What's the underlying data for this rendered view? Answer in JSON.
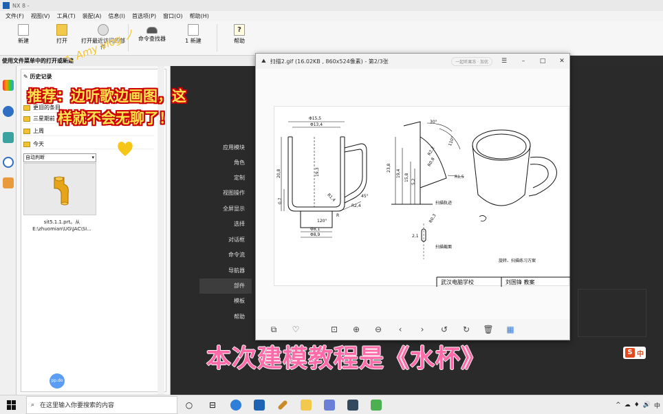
{
  "nx_window": {
    "title": "NX 8 -",
    "menu": [
      "文件(F)",
      "视图(V)",
      "工具(T)",
      "装配(A)",
      "信息(I)",
      "首选项(P)",
      "窗口(O)",
      "帮助(H)"
    ],
    "toolbar": {
      "new": "新建",
      "open": "打开",
      "recent": "打开最近访问的部件",
      "command_finder": "命令查找器",
      "new2": "1 新建",
      "help": "帮助"
    },
    "hint": "使用文件菜单中的打开或新建"
  },
  "history": {
    "title": "历史记录",
    "groups": [
      "更旧的条目",
      "三星期前",
      "上周",
      "今天"
    ],
    "filter": "自动判断",
    "file_line1": "sit5.1.1.prt。从",
    "file_line2": "E:\\zhuomian\\UG\\JAC\\SI..."
  },
  "right_menu": [
    "应用模块",
    "角色",
    "定制",
    "视图操作",
    "全屏显示",
    "选择",
    "对话框",
    "命令流",
    "导航器",
    "部件",
    "模板",
    "帮助"
  ],
  "viewer": {
    "title": "扫描2.gif (16.02KB , 860x524像素) - 第2/3张",
    "pill": "一起听果冻 · 加优",
    "window_buttons": [
      "☰",
      "–",
      "□",
      "✕"
    ],
    "bottom_icons": [
      "crop-icon",
      "heart-icon",
      "fit-icon",
      "zoom-in-icon",
      "zoom-out-icon",
      "prev-icon",
      "next-icon",
      "rotate-left-icon",
      "rotate-right-icon",
      "delete-icon",
      "grid-icon"
    ]
  },
  "drawing": {
    "dims": [
      "Φ15,5",
      "Φ13,4",
      "20,8",
      "19,3",
      "0,7",
      "R1,4",
      "R2,4",
      "Φ8,1",
      "Φ8,9",
      "120°",
      "R",
      "45°",
      "23,8",
      "19,4",
      "15,8",
      "5,2",
      "R2,2",
      "R0,8",
      "R1,5",
      "30°",
      "110°",
      "R0,3",
      "2,1"
    ],
    "labels": [
      "扫描轨迹",
      "扫描截面",
      "旋转、扫描练习方案"
    ],
    "table": [
      "武汉电脑学校",
      "刘国锋 教案"
    ]
  },
  "overlay": {
    "vlog": "ㄟ Amy vlog ノ",
    "line1": "推荐：边听歌边画图，这",
    "line2": "样就不会无聊了！",
    "subtitle": "本次建模教程是《水杯》",
    "ime": "中",
    "ime_s": "S",
    "baidu": "pp.do"
  },
  "taskbar": {
    "search_placeholder": "在这里输入你要搜索的内容",
    "tray": [
      "^",
      "☁",
      "♦",
      "🔊",
      "中"
    ]
  },
  "colors": {
    "subtitle_pink": "#ff6aa8",
    "overlay_yellow": "#ffe44d",
    "canvas_dark": "#2a2a2a"
  }
}
